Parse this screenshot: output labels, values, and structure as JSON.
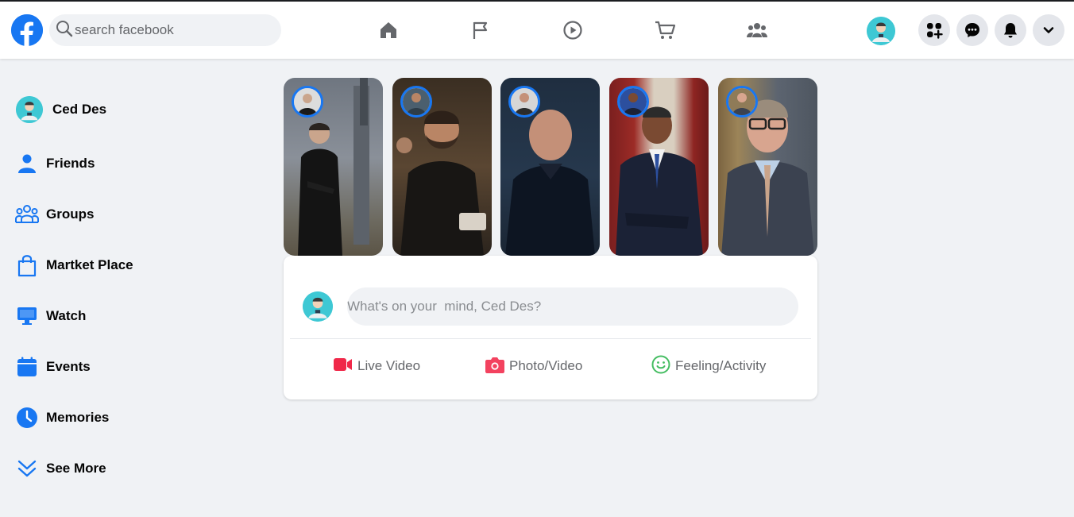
{
  "header": {
    "search_placeholder": "search facebook",
    "nav": [
      "home-icon",
      "pages-flag-icon",
      "watch-play-icon",
      "marketplace-cart-icon",
      "groups-icon"
    ],
    "actions": [
      "menu-grid-icon",
      "messenger-icon",
      "notifications-bell-icon",
      "account-chevron-icon"
    ]
  },
  "sidebar": {
    "profile_name": "Ced Des",
    "items": [
      {
        "label": "Friends",
        "icon": "friends-icon"
      },
      {
        "label": "Groups",
        "icon": "groups-icon"
      },
      {
        "label": "Martket Place",
        "icon": "marketplace-bag-icon"
      },
      {
        "label": "Watch",
        "icon": "watch-monitor-icon"
      },
      {
        "label": "Events",
        "icon": "calendar-icon"
      },
      {
        "label": "Memories",
        "icon": "clock-icon"
      },
      {
        "label": "See More",
        "icon": "double-chevron-down-icon"
      }
    ]
  },
  "composer": {
    "placeholder": "What's on your  mind, Ced Des?",
    "actions": [
      {
        "label": "Live Video",
        "icon": "video-camera-icon",
        "color": "#f02849"
      },
      {
        "label": "Photo/Video",
        "icon": "photo-camera-icon",
        "color": "#f3425f"
      },
      {
        "label": "Feeling/Activity",
        "icon": "smiley-icon",
        "color": "#45bd62"
      }
    ]
  },
  "colors": {
    "brand": "#1877f2",
    "background": "#f0f2f5",
    "avatar_bg": "#3ec8d4"
  }
}
